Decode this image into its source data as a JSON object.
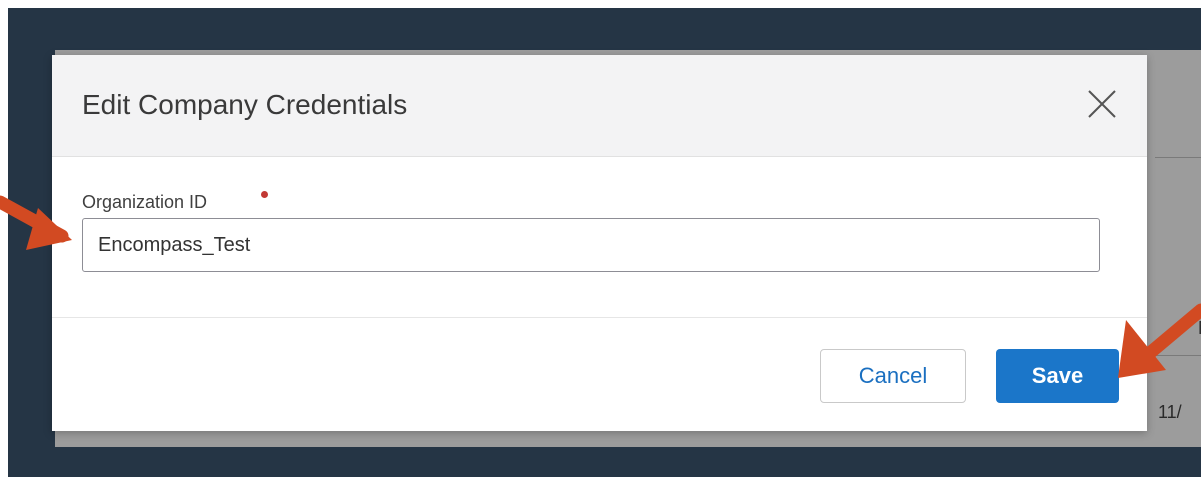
{
  "modal": {
    "title": "Edit Company Credentials",
    "close_icon": "close-icon"
  },
  "form": {
    "label": "Organization ID",
    "required": true,
    "value": "Encompass_Test"
  },
  "footer": {
    "cancel_label": "Cancel",
    "save_label": "Save"
  },
  "background": {
    "right_text_top": "M",
    "right_text_bottom": "11/"
  },
  "colors": {
    "frame": "#253545",
    "overlay": "#9c9c9c",
    "primary": "#1b76c9",
    "required": "#c23934",
    "annotation_arrow": "#d24a22"
  }
}
